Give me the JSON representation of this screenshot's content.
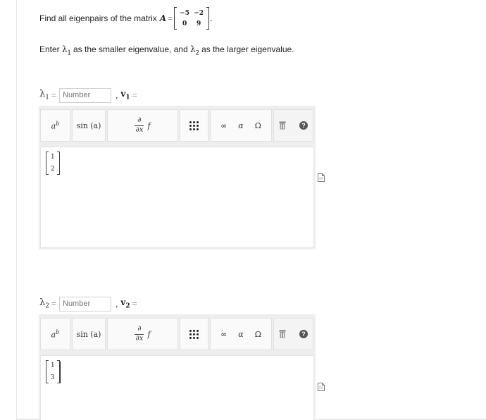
{
  "question": {
    "prefix": "Find all eigenpairs of the matrix",
    "matrix_name": "A",
    "equals": "=",
    "matrix": [
      [
        "−5",
        "−2"
      ],
      [
        "0",
        "9"
      ]
    ],
    "suffix": "."
  },
  "instruction": {
    "text_1": "Enter",
    "lambda_1": "λ",
    "sub_1": "1",
    "text_2": "as the smaller eigenvalue, and",
    "lambda_2": "λ",
    "sub_2": "2",
    "text_3": "as the larger eigenvalue."
  },
  "answers": [
    {
      "lambda": "λ",
      "sub": "1",
      "equals": "=",
      "input_placeholder": "Number",
      "comma": ",",
      "vector_symbol": "v",
      "vector_sub": "1",
      "vector_equals": "=",
      "vector_entries": [
        "1",
        "2"
      ]
    },
    {
      "lambda": "λ",
      "sub": "2",
      "equals": "=",
      "input_placeholder": "Number",
      "comma": ",",
      "vector_symbol": "v",
      "vector_sub": "2",
      "vector_equals": "=",
      "vector_entries": [
        "1",
        "3"
      ]
    }
  ],
  "toolbar": {
    "power_base": "a",
    "power_exp": "b",
    "sin_label": "sin (a)",
    "partial_top": "∂",
    "partial_bottom": "∂x",
    "f_label": "f",
    "infinity": "∞",
    "alpha": "α",
    "omega": "Ω",
    "help": "?"
  },
  "icons": [
    "superscript-icon",
    "sin-icon",
    "derivative-icon",
    "matrix-icon",
    "infinity-icon",
    "alpha-icon",
    "omega-icon",
    "trash-icon",
    "help-icon",
    "document-icon"
  ],
  "colors": {
    "editor_bg": "#eeeeee",
    "button_bg": "#fafafa",
    "border": "#cfcfcf",
    "help_bg": "#555555"
  }
}
